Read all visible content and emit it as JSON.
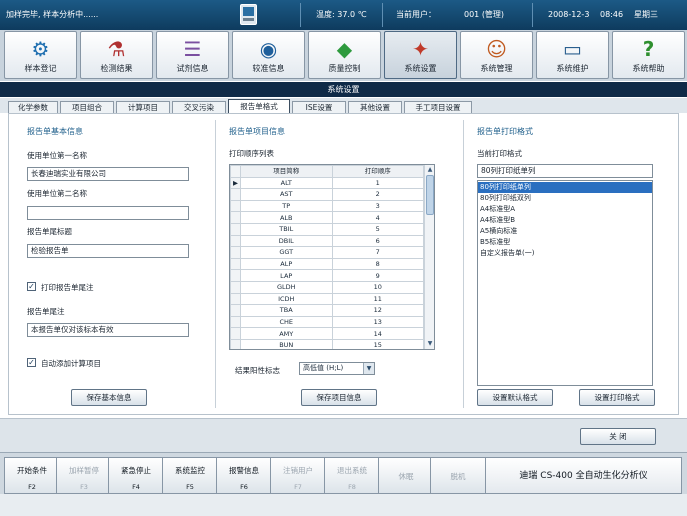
{
  "status_bar": {
    "message": "加样完毕, 样本分析中......",
    "temperature": "温度: 37.0 ℃",
    "current_user_label": "当前用户：",
    "current_user": "001 (管理)",
    "date": "2008-12-3",
    "time": "08:46",
    "weekday": "星期三"
  },
  "toolbar": [
    {
      "label": "样本登记",
      "icon": "gear-icon"
    },
    {
      "label": "检测结果",
      "icon": "flask-icon"
    },
    {
      "label": "试剂信息",
      "icon": "reagent-icon"
    },
    {
      "label": "较准信息",
      "icon": "calibration-icon"
    },
    {
      "label": "质量控制",
      "icon": "cubes-icon"
    },
    {
      "label": "系统设置",
      "icon": "settings-icon",
      "active": true
    },
    {
      "label": "系统管理",
      "icon": "users-icon"
    },
    {
      "label": "系统维护",
      "icon": "monitor-icon"
    },
    {
      "label": "系统帮助",
      "icon": "question-icon"
    }
  ],
  "panel_title": "系统设置",
  "tabs": [
    {
      "label": "化学参数"
    },
    {
      "label": "项目组合"
    },
    {
      "label": "计算项目"
    },
    {
      "label": "交叉污染"
    },
    {
      "label": "报告单格式",
      "active": true
    },
    {
      "label": "ISE设置"
    },
    {
      "label": "其他设置"
    },
    {
      "label": "手工项目设置"
    }
  ],
  "basic_info": {
    "title": "报告单基本信息",
    "unit1_label": "使用单位第一名称",
    "unit1_value": "长春迪瑞实业有限公司",
    "unit2_label": "使用单位第二名称",
    "unit2_value": "",
    "report_title_label": "报告单尾标题",
    "report_title_value": "检验报告单",
    "print_footer_label": "打印报告单尾注",
    "print_footer_checked": true,
    "footer_label": "报告单尾注",
    "footer_value": "本报告单仅对该标本有效",
    "auto_calc_label": "自动添加计算项目",
    "auto_calc_checked": true,
    "save_label": "保存基本信息"
  },
  "items_info": {
    "title": "报告单项目信息",
    "list_label": "打印顺序列表",
    "col_name": "项目简称",
    "col_order": "打印顺序",
    "rows": [
      {
        "name": "ALT",
        "order": "1"
      },
      {
        "name": "AST",
        "order": "2"
      },
      {
        "name": "TP",
        "order": "3"
      },
      {
        "name": "ALB",
        "order": "4"
      },
      {
        "name": "TBIL",
        "order": "5"
      },
      {
        "name": "DBIL",
        "order": "6"
      },
      {
        "name": "GGT",
        "order": "7"
      },
      {
        "name": "ALP",
        "order": "8"
      },
      {
        "name": "LAP",
        "order": "9"
      },
      {
        "name": "GLDH",
        "order": "10"
      },
      {
        "name": "ICDH",
        "order": "11"
      },
      {
        "name": "TBA",
        "order": "12"
      },
      {
        "name": "CHE",
        "order": "13"
      },
      {
        "name": "AMY",
        "order": "14"
      },
      {
        "name": "BUN",
        "order": "15"
      }
    ],
    "flag_label": "结果阳性标志",
    "flag_value": "高低值 (H;L)",
    "save_label": "保存项目信息"
  },
  "print_format": {
    "title": "报告单打印格式",
    "current_label": "当前打印格式",
    "current_value": "80列打印纸单列",
    "options": [
      "80列打印纸单列",
      "80列打印纸双列",
      "A4标准型A",
      "A4标准型B",
      "A5横向标准",
      "B5标准型",
      "自定义报告单(一)"
    ],
    "selected_index": 0,
    "default_label": "设置默认格式",
    "set_label": "设置打印格式"
  },
  "close_label": "关 闭",
  "function_keys": [
    {
      "name": "开始条件",
      "key": "F2",
      "enabled": true
    },
    {
      "name": "加样暂停",
      "key": "F3",
      "enabled": false
    },
    {
      "name": "紧急停止",
      "key": "F4",
      "enabled": true
    },
    {
      "name": "系统监控",
      "key": "F5",
      "enabled": true
    },
    {
      "name": "报警信息",
      "key": "F6",
      "enabled": true
    },
    {
      "name": "注销用户",
      "key": "F7",
      "enabled": false
    },
    {
      "name": "退出系统",
      "key": "F8",
      "enabled": false
    },
    {
      "name": "休眠",
      "key": "",
      "enabled": false
    },
    {
      "name": "脱机",
      "key": "",
      "enabled": false
    }
  ],
  "brand": "迪瑞 CS-400 全自动生化分析仪",
  "colors": {
    "status_bar": "#0e3b5e",
    "panel_title": "#0f2a47",
    "selection": "#2a6fc0",
    "section_title": "#1f5f8b"
  }
}
